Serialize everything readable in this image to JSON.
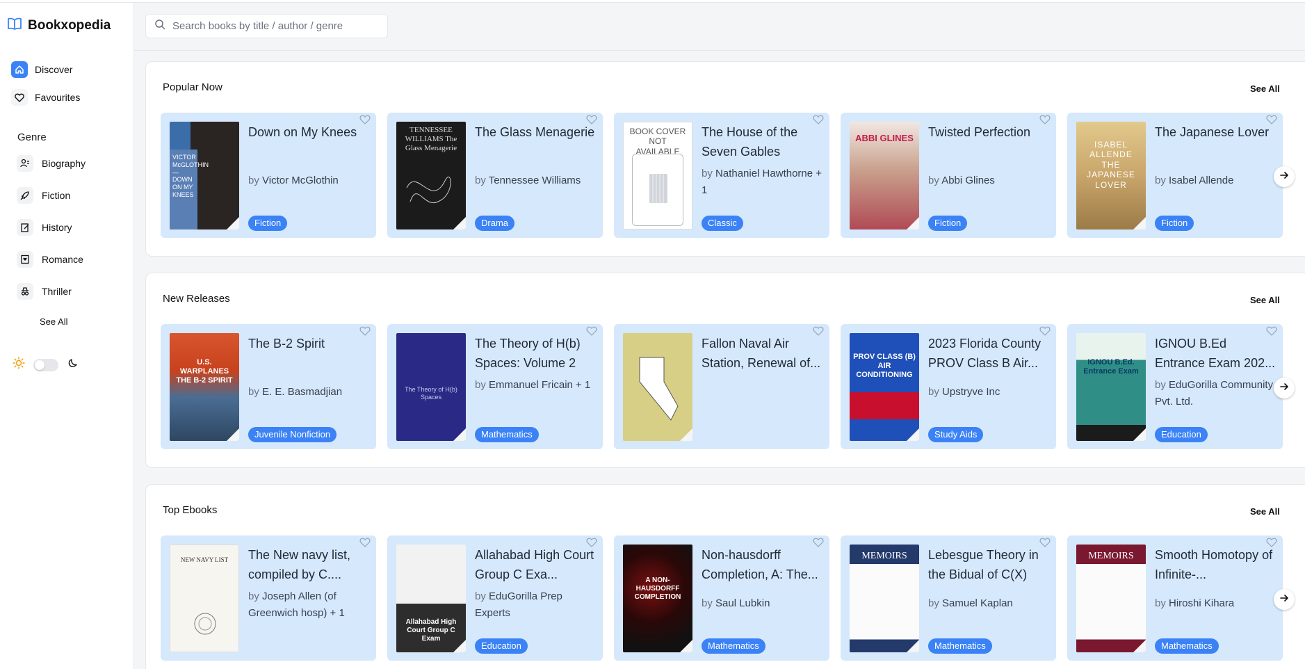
{
  "app": {
    "name": "Bookxopedia"
  },
  "search": {
    "placeholder": "Search books by title / author / genre"
  },
  "nav": [
    {
      "label": "Discover",
      "icon": "home-icon",
      "active": true
    },
    {
      "label": "Favourites",
      "icon": "heart-icon",
      "active": false
    }
  ],
  "genre": {
    "heading": "Genre",
    "items": [
      {
        "label": "Biography",
        "icon": "person-icon"
      },
      {
        "label": "Fiction",
        "icon": "rocket-icon"
      },
      {
        "label": "History",
        "icon": "edit-book-icon"
      },
      {
        "label": "Romance",
        "icon": "romance-book-icon"
      },
      {
        "label": "Thriller",
        "icon": "spy-icon"
      }
    ],
    "see_all": "See All"
  },
  "theme": {
    "light_icon": "sun-icon",
    "dark_icon": "moon-icon"
  },
  "sections": [
    {
      "title": "Popular Now",
      "see_all": "See All",
      "books": [
        {
          "title": "Down on My Knees",
          "by": "by",
          "author": "Victor McGlothin",
          "genre": "Fiction",
          "cover_color": "#3b6ea8",
          "cover_text": "VICTOR McGLOTHIN — DOWN ON MY KNEES"
        },
        {
          "title": "The Glass Menagerie",
          "by": "by",
          "author": "Tennessee Williams",
          "genre": "Drama",
          "cover_color": "#1b1b1b",
          "cover_text": "TENNESSEE WILLIAMS The Glass Menagerie"
        },
        {
          "title": "The House of the Seven Gables",
          "by": "by",
          "author": "Nathaniel Hawthorne + 1",
          "genre": "Classic",
          "cover_color": "#ffffff",
          "cover_text": "BOOK COVER NOT AVAILABLE"
        },
        {
          "title": "Twisted Perfection",
          "by": "by",
          "author": "Abbi Glines",
          "genre": "Fiction",
          "cover_color": "#c9a08c",
          "cover_text": "ABBI GLINES"
        },
        {
          "title": "The Japanese Lover",
          "by": "by",
          "author": "Isabel Allende",
          "genre": "Fiction",
          "cover_color": "#c9a56a",
          "cover_text": "ISABEL ALLENDE THE JAPANESE LOVER"
        }
      ]
    },
    {
      "title": "New Releases",
      "see_all": "See All",
      "books": [
        {
          "title": "The B-2 Spirit",
          "by": "by",
          "author": "E. E. Basmadjian",
          "genre": "Juvenile Nonfiction",
          "cover_color": "#4a6d93",
          "cover_text": "U.S. WARPLANES THE B-2 SPIRIT"
        },
        {
          "title": "The Theory of H(b) Spaces: Volume 2",
          "by": "by",
          "author": "Emmanuel Fricain + 1",
          "genre": "Mathematics",
          "cover_color": "#2a2a86",
          "cover_text": "The Theory of H(b) Spaces"
        },
        {
          "title": "Fallon Naval Air Station, Renewal of...",
          "by": "",
          "author": "",
          "genre": "",
          "cover_color": "#d8cf86",
          "cover_text": ""
        },
        {
          "title": "2023 Florida County PROV Class B Air...",
          "by": "by",
          "author": "Upstryve Inc",
          "genre": "Study Aids",
          "cover_color": "#1f4fb8",
          "cover_text": "PROV CLASS (B) AIR CONDITIONING"
        },
        {
          "title": "IGNOU B.Ed Entrance Exam 202...",
          "by": "by",
          "author": "EduGorilla Community Pvt. Ltd.",
          "genre": "Education",
          "cover_color": "#2f8f87",
          "cover_text": "IGNOU B.Ed. Entrance Exam"
        }
      ]
    },
    {
      "title": "Top Ebooks",
      "see_all": "See All",
      "books": [
        {
          "title": "The New navy list, compiled by C....",
          "by": "by",
          "author": "Joseph Allen (of Greenwich hosp) + 1",
          "genre": "",
          "cover_color": "#f7f5ef",
          "cover_text": "NEW NAVY LIST"
        },
        {
          "title": "Allahabad High Court Group C Exa...",
          "by": "by",
          "author": "EduGorilla Prep Experts",
          "genre": "Education",
          "cover_color": "#2d2d2d",
          "cover_text": "Allahabad High Court Group C Exam"
        },
        {
          "title": "Non-hausdorff Completion, A: The...",
          "by": "by",
          "author": "Saul Lubkin",
          "genre": "Mathematics",
          "cover_color": "#1a1a1a",
          "cover_text": "A NON-HAUSDORFF COMPLETION"
        },
        {
          "title": "Lebesgue Theory in the Bidual of C(X)",
          "by": "by",
          "author": "Samuel Kaplan",
          "genre": "Mathematics",
          "cover_color": "#233a6b",
          "cover_text": "MEMOIRS"
        },
        {
          "title": "Smooth Homotopy of Infinite-...",
          "by": "by",
          "author": "Hiroshi Kihara",
          "genre": "Mathematics",
          "cover_color": "#7a1830",
          "cover_text": "MEMOIRS"
        }
      ]
    }
  ]
}
